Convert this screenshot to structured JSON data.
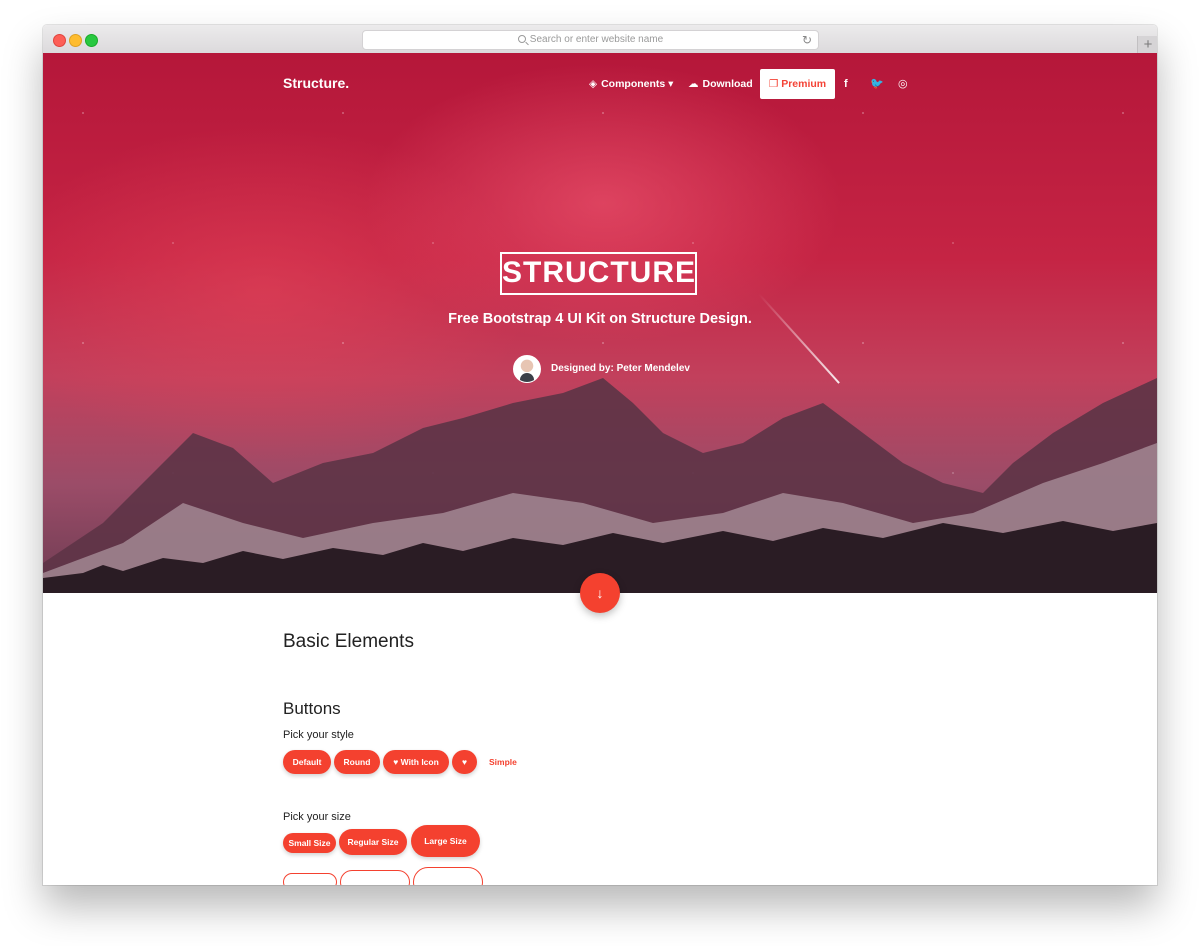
{
  "browser": {
    "url_placeholder": "Search or enter website name",
    "reload_icon": "↻",
    "new_tab_icon": "+"
  },
  "nav": {
    "brand": "Structure.",
    "components_label": "Components",
    "download_label": "Download",
    "premium_label": "Premium",
    "facebook_icon": "f",
    "twitter_icon": "🐦",
    "instagram_icon": "◎",
    "layers_icon": "◈",
    "download_icon": "☁",
    "premium_icon": "❐"
  },
  "hero": {
    "title": "STRUCTURE",
    "subtitle": "Free Bootstrap 4 UI Kit on Structure Design.",
    "designed_by_label": "Designed by:",
    "designer_name": "Peter Mendelev",
    "scroll_icon": "↓"
  },
  "colors": {
    "accent": "#f4412f",
    "hero_top": "#b5173a"
  },
  "content": {
    "section_title": "Basic Elements",
    "buttons_title": "Buttons",
    "pick_style_label": "Pick your style",
    "pick_size_label": "Pick your size",
    "style_buttons": {
      "default": "Default",
      "round": "Round",
      "with_icon": "With Icon",
      "heart_icon": "♥",
      "simple": "Simple"
    },
    "size_buttons": {
      "small": "Small Size",
      "regular": "Regular Size",
      "large": "Large Size"
    }
  }
}
